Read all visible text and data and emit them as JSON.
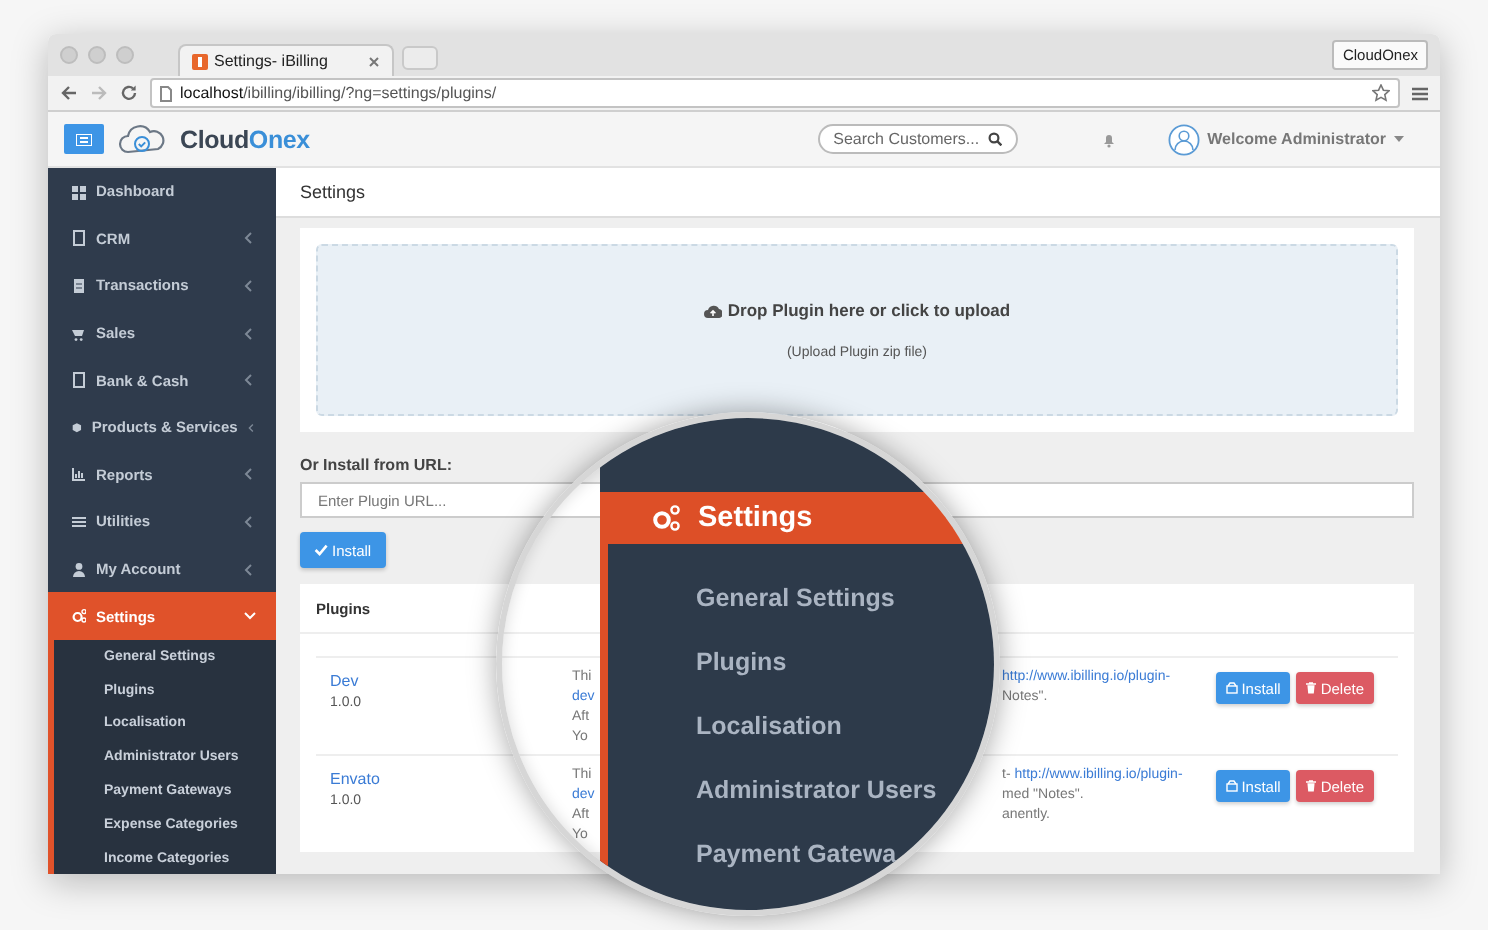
{
  "browser": {
    "tab_title": "Settings- iBilling",
    "profile": "CloudOnex",
    "url_host": "localhost",
    "url_path": "/ibilling/ibilling/?ng=settings/plugins/"
  },
  "header": {
    "logo_dark": "Cloud",
    "logo_accent": "Onex",
    "search": {
      "placeholder": "Search Customers..."
    },
    "user": "Welcome Administrator"
  },
  "sidebar": {
    "items": [
      {
        "label": "Dashboard",
        "kind": "link",
        "selected": false
      },
      {
        "label": "CRM",
        "kind": "group",
        "selected": false,
        "expanded": false
      },
      {
        "label": "Transactions",
        "kind": "group",
        "selected": false,
        "expanded": false
      },
      {
        "label": "Sales",
        "kind": "group",
        "selected": false,
        "expanded": false
      },
      {
        "label": "Bank & Cash",
        "kind": "group",
        "selected": false,
        "expanded": false
      },
      {
        "label": "Products & Services",
        "kind": "group",
        "selected": false,
        "expanded": false
      },
      {
        "label": "Reports",
        "kind": "group",
        "selected": false,
        "expanded": false
      },
      {
        "label": "Utilities",
        "kind": "group",
        "selected": false,
        "expanded": false
      },
      {
        "label": "My Account",
        "kind": "group",
        "selected": false,
        "expanded": false
      },
      {
        "label": "Settings",
        "kind": "group",
        "selected": true,
        "expanded": true,
        "children": [
          {
            "label": "General Settings"
          },
          {
            "label": "Plugins"
          },
          {
            "label": "Localisation"
          },
          {
            "label": "Administrator Users"
          },
          {
            "label": "Payment Gateways"
          },
          {
            "label": "Expense Categories"
          },
          {
            "label": "Income Categories"
          }
        ]
      }
    ]
  },
  "page_title": "Settings",
  "upload": {
    "title": "Drop Plugin here or click to upload",
    "hint": "(Upload Plugin zip file)"
  },
  "url_install": {
    "label": "Or Install from URL:",
    "placeholder": "Enter Plugin URL...",
    "button": "Install"
  },
  "plugins": {
    "title": "Plugins",
    "rows": [
      {
        "name": "Dev",
        "version": "1.0.0",
        "desc_left": [
          {
            "text": "Thi",
            "link": false
          },
          {
            "text": "dev",
            "link": true
          },
          {
            "text": "Aft",
            "link": false
          },
          {
            "text": "Yo",
            "link": false
          }
        ],
        "desc_right": [
          {
            "text": "http://www.ibilling.io/plugin-",
            "link": true
          },
          {
            "text": "Notes\".",
            "link": false
          }
        ],
        "install": "Install",
        "delete": "Delete"
      },
      {
        "name": "Envato",
        "version": "1.0.0",
        "desc_left": [
          {
            "text": "Thi",
            "link": false
          },
          {
            "text": "dev",
            "link": true
          },
          {
            "text": "Aft",
            "link": false
          },
          {
            "text": "Yo",
            "link": false
          }
        ],
        "desc_right": [
          {
            "text": "t-",
            "link": false
          },
          {
            "text": "http://www.ibilling.io/plugin-",
            "link": true
          },
          {
            "text": "med \"Notes\".",
            "link": false
          },
          {
            "text": "anently.",
            "link": false
          }
        ],
        "install": "Install",
        "delete": "Delete"
      }
    ]
  },
  "magnifier": {
    "header": "Settings",
    "items": [
      "General Settings",
      "Plugins",
      "Localisation",
      "Administrator Users",
      "Payment Gatewa"
    ]
  }
}
